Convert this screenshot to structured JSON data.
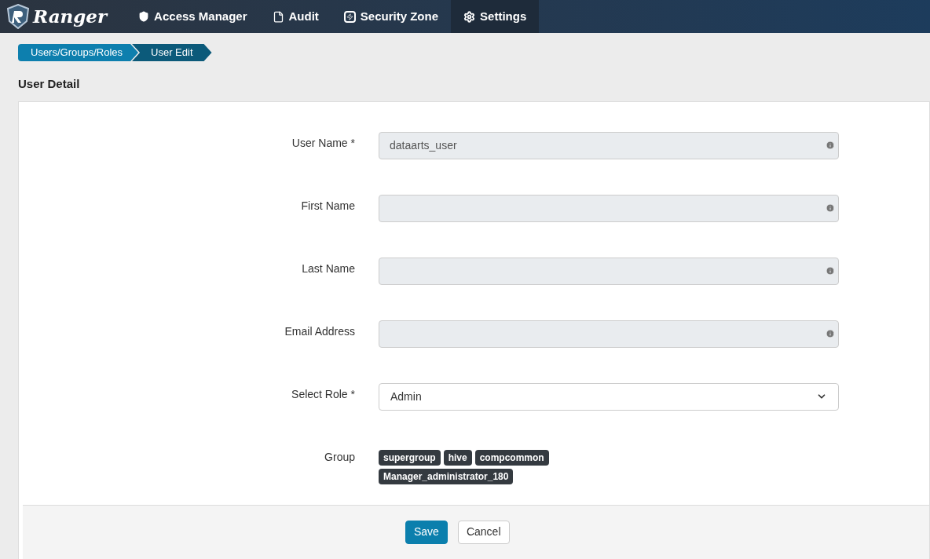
{
  "brand": "Ranger",
  "nav": [
    {
      "label": "Access Manager",
      "selected": false
    },
    {
      "label": "Audit",
      "selected": false
    },
    {
      "label": "Security Zone",
      "selected": false
    },
    {
      "label": "Settings",
      "selected": true
    }
  ],
  "breadcrumb": [
    "Users/Groups/Roles",
    "User Edit"
  ],
  "title": "User Detail",
  "fields": [
    {
      "label": "User Name *",
      "kind": "text",
      "value": "dataarts_user"
    },
    {
      "label": "First Name",
      "kind": "text"
    },
    {
      "label": "Last Name",
      "kind": "text"
    },
    {
      "label": "Email Address",
      "kind": "text"
    },
    {
      "label": "Select Role *",
      "kind": "select",
      "value": "Admin"
    }
  ],
  "group": {
    "label": "Group",
    "tags": [
      "supergroup",
      "hive",
      "compcommon",
      "Manager_administrator_180"
    ]
  },
  "buttons": [
    {
      "label": "Save",
      "kind": "primary"
    },
    {
      "label": "Cancel",
      "kind": "default"
    }
  ]
}
